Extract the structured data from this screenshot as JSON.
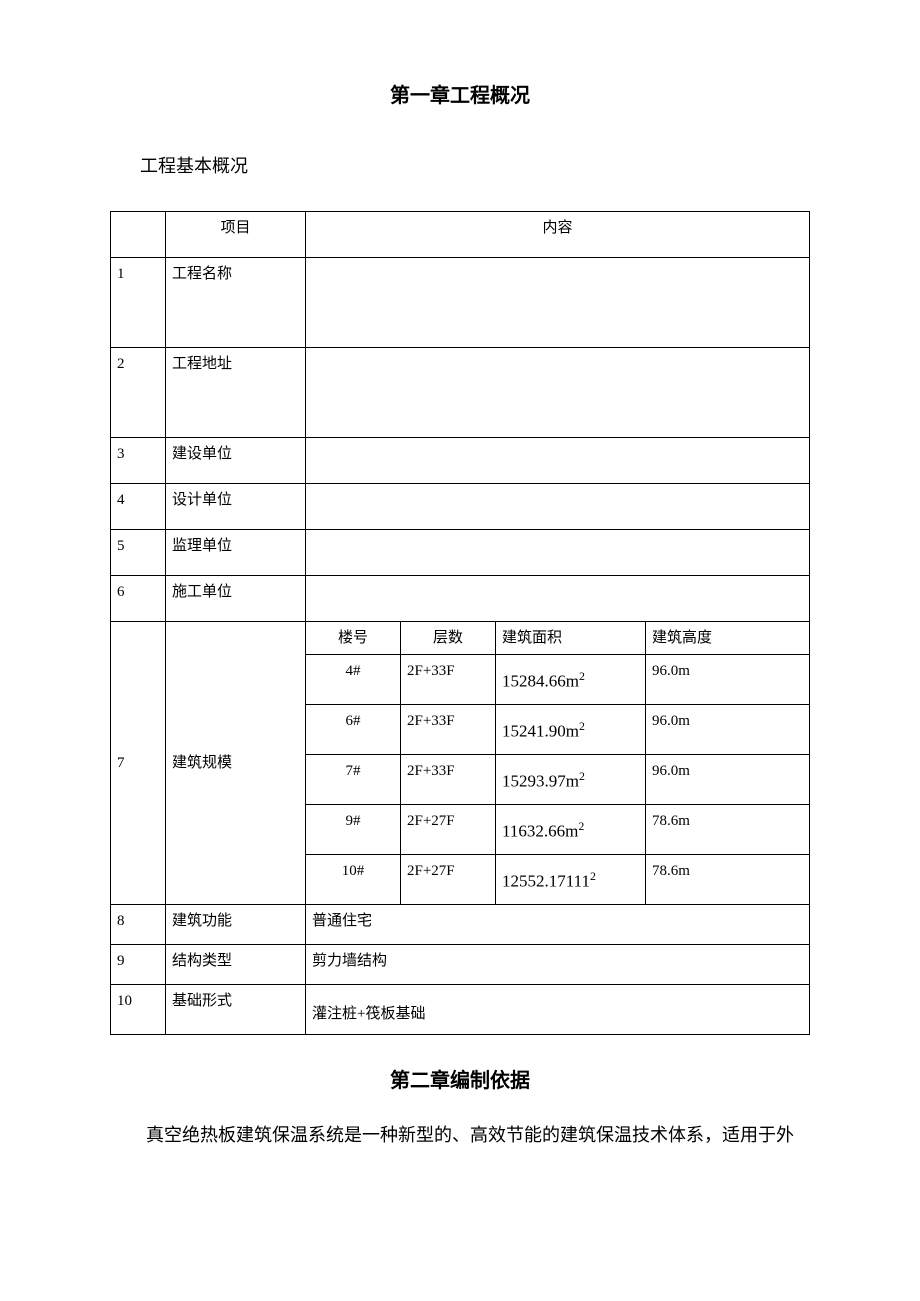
{
  "chapter1_title": "第一章工程概况",
  "subtitle": "工程基本概况",
  "header": {
    "item": "项目",
    "content": "内容"
  },
  "rows": {
    "r1": {
      "n": "1",
      "label": "工程名称",
      "val": ""
    },
    "r2": {
      "n": "2",
      "label": "工程地址",
      "val": ""
    },
    "r3": {
      "n": "3",
      "label": "建设单位",
      "val": ""
    },
    "r4": {
      "n": "4",
      "label": "设计单位",
      "val": ""
    },
    "r5": {
      "n": "5",
      "label": "监理单位",
      "val": ""
    },
    "r6": {
      "n": "6",
      "label": "施工单位",
      "val": ""
    },
    "r7": {
      "n": "7",
      "label": "建筑规模"
    },
    "r8": {
      "n": "8",
      "label": "建筑功能",
      "val": "普通住宅"
    },
    "r9": {
      "n": "9",
      "label": "结构类型",
      "val": "剪力墙结构"
    },
    "r10": {
      "n": "10",
      "label": "基础形式",
      "val": "灌注桩+筏板基础"
    }
  },
  "scale_header": {
    "c1": "楼号",
    "c2": "层数",
    "c3": "建筑面积",
    "c4": "建筑高度"
  },
  "scale": [
    {
      "c1": "4#",
      "c2": "2F+33F",
      "area_num": "15284.66m",
      "area_sup": "2",
      "c4": "96.0m"
    },
    {
      "c1": "6#",
      "c2": "2F+33F",
      "area_num": "15241.90m",
      "area_sup": "2",
      "c4": "96.0m"
    },
    {
      "c1": "7#",
      "c2": "2F+33F",
      "area_num": "15293.97m",
      "area_sup": "2",
      "c4": "96.0m"
    },
    {
      "c1": "9#",
      "c2": "2F+27F",
      "area_num": "11632.66m",
      "area_sup": "2",
      "c4": "78.6m"
    },
    {
      "c1": "10#",
      "c2": "2F+27F",
      "area_num": "12552.17111",
      "area_sup": "2",
      "c4": "78.6m"
    }
  ],
  "chapter2_title": "第二章编制依据",
  "paragraph": "真空绝热板建筑保温系统是一种新型的、高效节能的建筑保温技术体系，适用于外"
}
